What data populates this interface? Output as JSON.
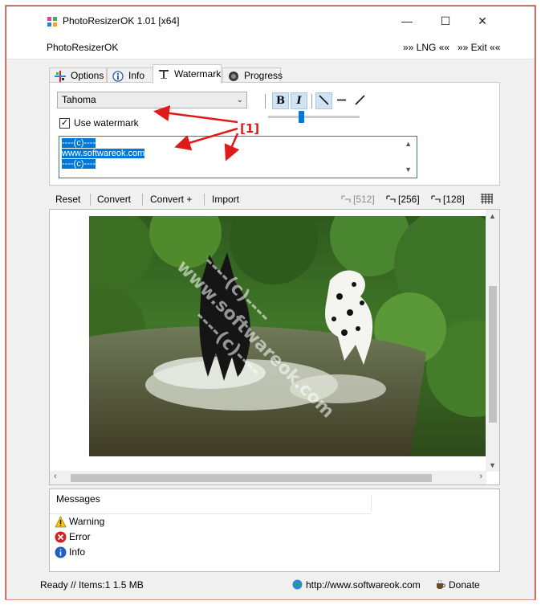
{
  "window": {
    "title": "PhotoResizerOK 1.01 [x64]",
    "minimize_glyph": "—",
    "maximize_glyph": "☐",
    "close_glyph": "✕"
  },
  "menubar": {
    "app_name": "PhotoResizerOK",
    "lng_label": "»» LNG ««",
    "exit_label": "»» Exit ««"
  },
  "tabs": [
    {
      "label": "Options",
      "icon": "options-icon",
      "active": false
    },
    {
      "label": "Info",
      "icon": "info-icon",
      "active": false
    },
    {
      "label": "Watermark",
      "icon": "watermark-icon",
      "active": true
    },
    {
      "label": "Progress",
      "icon": "progress-icon",
      "active": false
    }
  ],
  "watermark": {
    "font_name": "Tahoma",
    "bold_label": "B",
    "italic_label": "I",
    "use_watermark_label": "Use watermark",
    "use_watermark_checked": true,
    "text_lines": [
      "----(c)----",
      "www.softwareok.com",
      "----(c)----"
    ],
    "annotation": "[1]",
    "annotation_color": "#e0191b"
  },
  "toolbar": {
    "reset": "Reset",
    "convert": "Convert",
    "convert_plus": "Convert +",
    "import": "Import",
    "size_512": "[512]",
    "size_256": "[256]",
    "size_128": "[128]"
  },
  "preview": {
    "watermark_lines": [
      "----(c)----",
      "www.softwareok.com",
      "----(c)----"
    ]
  },
  "messages": {
    "header": "Messages",
    "items": [
      {
        "label": "Warning",
        "icon": "warning-icon"
      },
      {
        "label": "Error",
        "icon": "error-icon"
      },
      {
        "label": "Info",
        "icon": "info-icon"
      }
    ]
  },
  "statusbar": {
    "status": "Ready // Items:1 1.5 MB",
    "url": "http://www.softwareok.com",
    "donate": "Donate"
  },
  "colors": {
    "accent": "#0078d7",
    "window_border": "#b04c38",
    "selection": "#0078d7"
  }
}
